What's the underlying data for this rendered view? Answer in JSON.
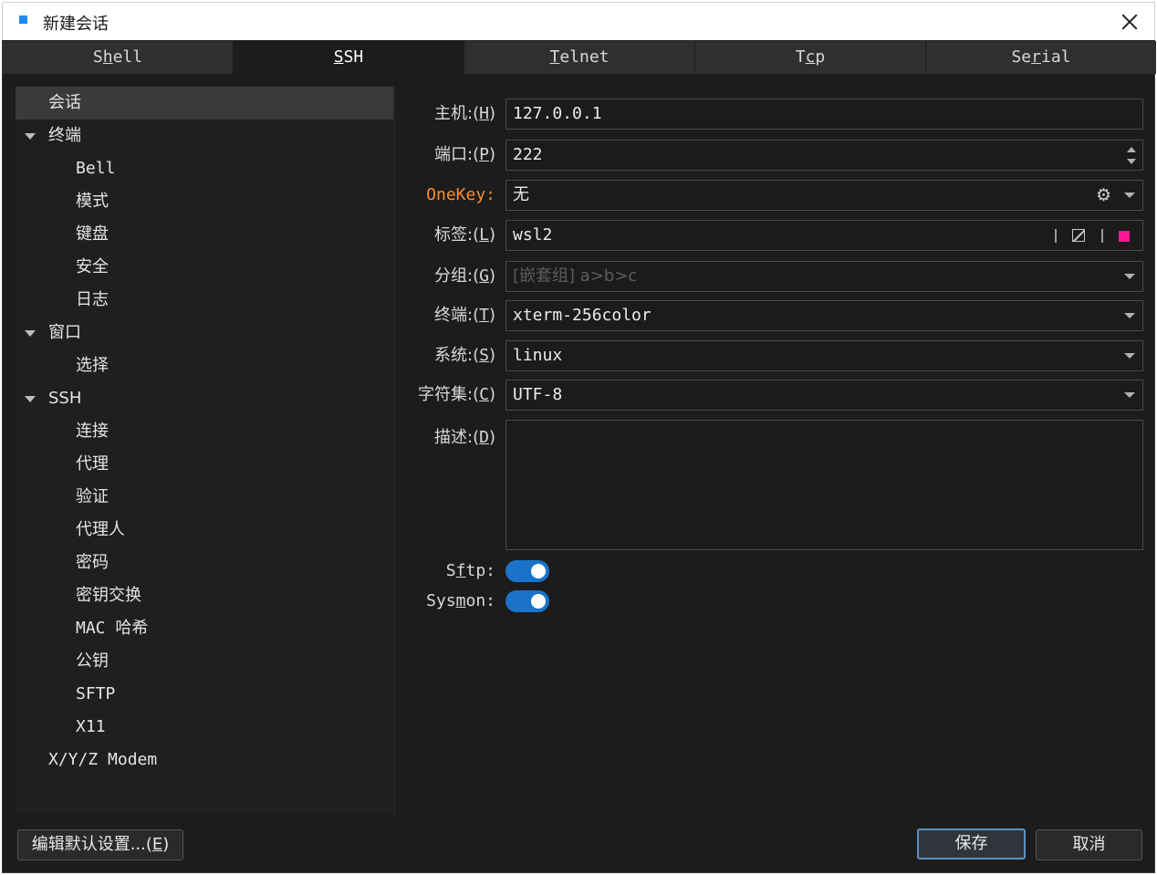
{
  "window": {
    "title": "新建会话",
    "icon": "app-icon",
    "close_icon": "close-icon"
  },
  "tabs": [
    {
      "label": "Shell",
      "active": false
    },
    {
      "label": "SSH",
      "active": true
    },
    {
      "label": "Telnet",
      "active": false
    },
    {
      "label": "Tcp",
      "active": false
    },
    {
      "label": "Serial",
      "active": false
    }
  ],
  "sidebar": {
    "items": [
      {
        "label": "会话",
        "level": 0,
        "expandable": false,
        "selected": true
      },
      {
        "label": "终端",
        "level": 0,
        "expandable": true,
        "selected": false
      },
      {
        "label": "Bell",
        "level": 1
      },
      {
        "label": "模式",
        "level": 1
      },
      {
        "label": "键盘",
        "level": 1
      },
      {
        "label": "安全",
        "level": 1
      },
      {
        "label": "日志",
        "level": 1
      },
      {
        "label": "窗口",
        "level": 0,
        "expandable": true
      },
      {
        "label": "选择",
        "level": 1
      },
      {
        "label": "SSH",
        "level": 0,
        "expandable": true
      },
      {
        "label": "连接",
        "level": 1
      },
      {
        "label": "代理",
        "level": 1
      },
      {
        "label": "验证",
        "level": 1
      },
      {
        "label": "代理人",
        "level": 1
      },
      {
        "label": "密码",
        "level": 1
      },
      {
        "label": "密钥交换",
        "level": 1
      },
      {
        "label": "MAC 哈希",
        "level": 1
      },
      {
        "label": "公钥",
        "level": 1
      },
      {
        "label": "SFTP",
        "level": 1
      },
      {
        "label": "X11",
        "level": 1
      },
      {
        "label": "X/Y/Z Modem",
        "level": 0,
        "expandable": false
      }
    ]
  },
  "form": {
    "host": {
      "label": "主机:(H)",
      "value": "127.0.0.1"
    },
    "port": {
      "label": "端口:(P)",
      "value": "222"
    },
    "onekey": {
      "label": "OneKey:",
      "value": "无",
      "label_color": "#ff8a2a"
    },
    "tag": {
      "label": "标签:(L)",
      "value": "wsl2",
      "color": "#ff1493"
    },
    "group": {
      "label": "分组:(G)",
      "placeholder": "[嵌套组] a>b>c"
    },
    "terminal": {
      "label": "终端:(T)",
      "value": "xterm-256color"
    },
    "system": {
      "label": "系统:(S)",
      "value": "linux"
    },
    "charset": {
      "label": "字符集:(C)",
      "value": "UTF-8"
    },
    "description": {
      "label": "描述:(D)",
      "value": ""
    },
    "sftp": {
      "label": "Sftp:",
      "enabled": true
    },
    "sysmon": {
      "label": "Sysmon:",
      "enabled": true
    }
  },
  "buttons": {
    "edit_defaults": "编辑默认设置...(E)",
    "save": "保存",
    "cancel": "取消"
  },
  "colors": {
    "toggle_on": "#1a73c8",
    "accent_label": "#ff8a2a",
    "tag_color": "#ff1493"
  }
}
